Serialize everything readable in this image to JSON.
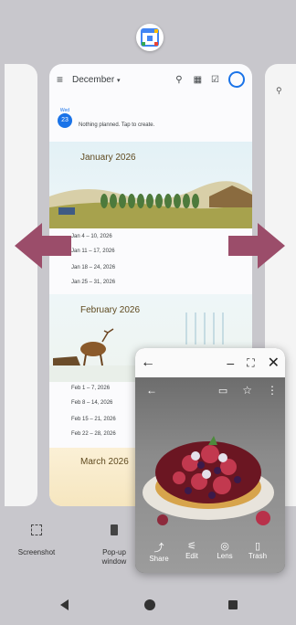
{
  "calendar": {
    "header_month": "December",
    "today_day_label": "Wed",
    "today_day_number": "23",
    "today_text": "Nothing planned. Tap to create.",
    "months": [
      {
        "title": "January 2026",
        "weeks": [
          "Jan 4 – 10, 2026",
          "Jan 11 – 17, 2026",
          "Jan 18 – 24, 2026",
          "Jan 25 – 31, 2026"
        ]
      },
      {
        "title": "February 2026",
        "weeks": [
          "Feb 1 – 7, 2026",
          "Feb 8 – 14, 2026",
          "Feb 15 – 21, 2026",
          "Feb 22 – 28, 2026"
        ]
      },
      {
        "title": "March 2026"
      }
    ]
  },
  "popup": {
    "buttons": [
      {
        "label": "Share",
        "icon": "share-icon"
      },
      {
        "label": "Edit",
        "icon": "edit-icon"
      },
      {
        "label": "Lens",
        "icon": "lens-icon"
      },
      {
        "label": "Trash",
        "icon": "trash-icon"
      }
    ]
  },
  "actions": {
    "screenshot_label": "Screenshot",
    "popup_label_line1": "Pop-up",
    "popup_label_line2": "window"
  },
  "colors": {
    "arrow": "#9b4d6a",
    "accent_blue": "#1a73e8"
  }
}
